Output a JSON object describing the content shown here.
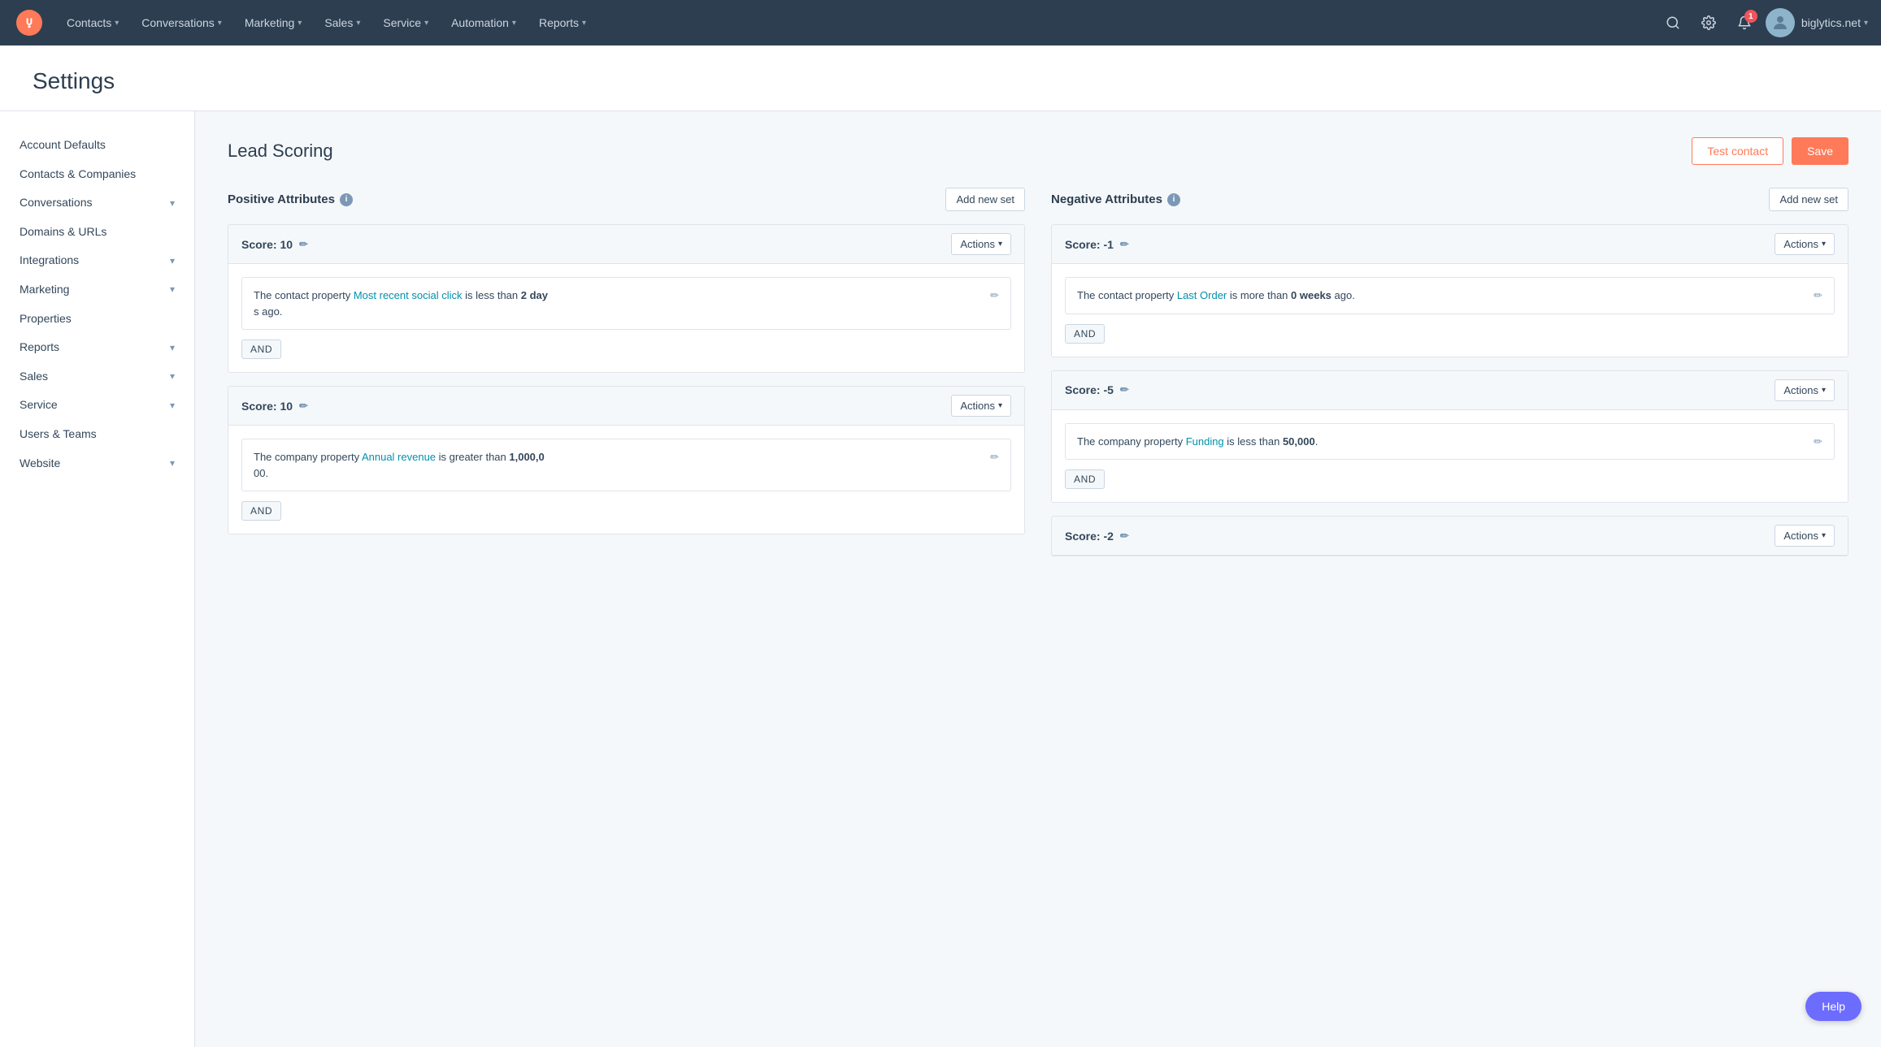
{
  "topnav": {
    "logo_label": "HubSpot",
    "links": [
      {
        "label": "Contacts",
        "id": "contacts"
      },
      {
        "label": "Conversations",
        "id": "conversations"
      },
      {
        "label": "Marketing",
        "id": "marketing"
      },
      {
        "label": "Sales",
        "id": "sales"
      },
      {
        "label": "Service",
        "id": "service"
      },
      {
        "label": "Automation",
        "id": "automation"
      },
      {
        "label": "Reports",
        "id": "reports"
      }
    ],
    "notification_count": "1",
    "account_name": "biglytics.net"
  },
  "page": {
    "title": "Settings"
  },
  "sidebar": {
    "items": [
      {
        "label": "Account Defaults",
        "id": "account-defaults",
        "has_chevron": false
      },
      {
        "label": "Contacts & Companies",
        "id": "contacts-companies",
        "has_chevron": false
      },
      {
        "label": "Conversations",
        "id": "conversations",
        "has_chevron": true
      },
      {
        "label": "Domains & URLs",
        "id": "domains-urls",
        "has_chevron": false
      },
      {
        "label": "Integrations",
        "id": "integrations",
        "has_chevron": true
      },
      {
        "label": "Marketing",
        "id": "marketing",
        "has_chevron": true
      },
      {
        "label": "Properties",
        "id": "properties",
        "has_chevron": false
      },
      {
        "label": "Reports",
        "id": "reports",
        "has_chevron": true
      },
      {
        "label": "Sales",
        "id": "sales",
        "has_chevron": true
      },
      {
        "label": "Service",
        "id": "service",
        "has_chevron": true
      },
      {
        "label": "Users & Teams",
        "id": "users-teams",
        "has_chevron": false
      },
      {
        "label": "Website",
        "id": "website",
        "has_chevron": true
      }
    ]
  },
  "lead_scoring": {
    "title": "Lead Scoring",
    "test_contact_label": "Test contact",
    "save_label": "Save",
    "positive_attributes": {
      "title": "Positive Attributes",
      "add_new_set_label": "Add new set",
      "cards": [
        {
          "id": "pos-1",
          "score_label": "Score:",
          "score_value": "10",
          "actions_label": "Actions",
          "condition_text_prefix": "The contact property ",
          "condition_link": "Most recent social click",
          "condition_text_middle": " is less than ",
          "condition_bold": "2 day",
          "condition_text_suffix": "s ago.",
          "and_label": "AND"
        },
        {
          "id": "pos-2",
          "score_label": "Score:",
          "score_value": "10",
          "actions_label": "Actions",
          "condition_text_prefix": "The company property ",
          "condition_link": "Annual revenue",
          "condition_text_middle": " is greater than ",
          "condition_bold": "1,000,0",
          "condition_text_suffix": "00.",
          "and_label": "AND"
        }
      ]
    },
    "negative_attributes": {
      "title": "Negative Attributes",
      "add_new_set_label": "Add new set",
      "cards": [
        {
          "id": "neg-1",
          "score_label": "Score:",
          "score_value": "-1",
          "actions_label": "Actions",
          "condition_text_prefix": "The contact property ",
          "condition_link": "Last Order",
          "condition_text_middle": " is more than ",
          "condition_bold": "0 weeks",
          "condition_text_suffix": " ago.",
          "and_label": "AND"
        },
        {
          "id": "neg-2",
          "score_label": "Score:",
          "score_value": "-5",
          "actions_label": "Actions",
          "condition_text_prefix": "The company property ",
          "condition_link": "Funding",
          "condition_text_middle": " is less than ",
          "condition_bold": "50,000",
          "condition_text_suffix": ".",
          "and_label": "AND"
        },
        {
          "id": "neg-3",
          "score_label": "Score:",
          "score_value": "-2",
          "actions_label": "Actions"
        }
      ]
    }
  },
  "help": {
    "label": "Help"
  }
}
